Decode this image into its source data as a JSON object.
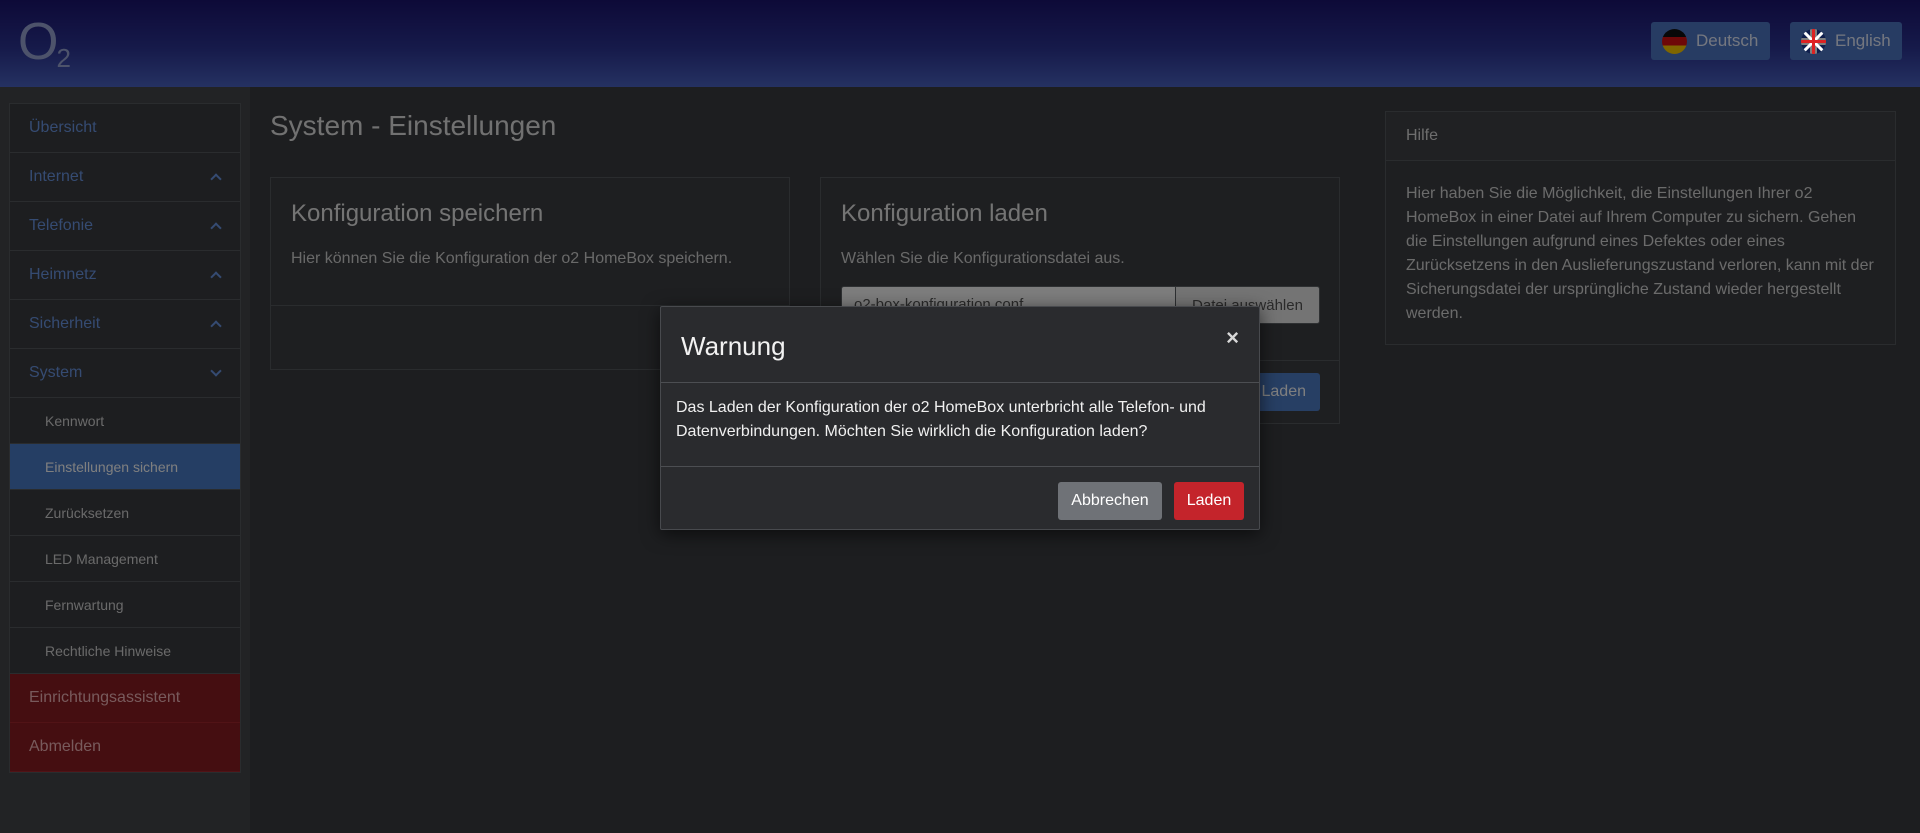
{
  "header": {
    "logo": "O2",
    "languages": [
      {
        "label": "Deutsch",
        "flag": "de-flag-icon"
      },
      {
        "label": "English",
        "flag": "uk-flag-icon"
      }
    ]
  },
  "sidebar": {
    "items": [
      {
        "label": "Übersicht"
      },
      {
        "label": "Internet",
        "icon": "chevron-up-icon"
      },
      {
        "label": "Telefonie",
        "icon": "chevron-up-icon"
      },
      {
        "label": "Heimnetz",
        "icon": "chevron-up-icon"
      },
      {
        "label": "Sicherheit",
        "icon": "chevron-up-icon"
      },
      {
        "label": "System",
        "icon": "chevron-down-icon"
      }
    ],
    "sub_items": [
      {
        "label": "Kennwort"
      },
      {
        "label": "Einstellungen sichern",
        "active": true
      },
      {
        "label": "Zurücksetzen"
      },
      {
        "label": "LED Management"
      },
      {
        "label": "Fernwartung"
      },
      {
        "label": "Rechtliche Hinweise"
      }
    ],
    "bottom_items": [
      {
        "label": "Einrichtungsassistent"
      },
      {
        "label": "Abmelden"
      }
    ]
  },
  "main": {
    "page_title": "System - Einstellungen",
    "save_panel": {
      "title": "Konfiguration speichern",
      "description": "Hier können Sie die Konfiguration der o2 HomeBox speichern."
    },
    "load_panel": {
      "title": "Konfiguration laden",
      "description": "Wählen Sie die Konfigurationsdatei aus.",
      "file_value": "o2-box-konfiguration.conf",
      "file_button": "Datei auswählen",
      "load_button": "Laden"
    },
    "help": {
      "title": "Hilfe",
      "text": "Hier haben Sie die Möglichkeit, die Einstellungen Ihrer o2 HomeBox in einer Datei auf Ihrem Computer zu sichern. Gehen die Einstellungen aufgrund eines Defektes oder eines Zurücksetzens in den Auslieferungszustand verloren, kann mit der Sicherungsdatei der ursprüngliche Zustand wieder hergestellt werden."
    }
  },
  "modal": {
    "title": "Warnung",
    "close": "×",
    "body": "Das Laden der Konfiguration der o2 HomeBox unterbricht alle Telefon- und Datenverbindungen. Möchten Sie wirklich die Konfiguration laden?",
    "cancel_label": "Abbrechen",
    "confirm_label": "Laden"
  },
  "colors": {
    "header_gradient_top": "#1b1470",
    "header_gradient_bottom": "#4a63c4",
    "link_blue": "#6b97e4",
    "active_item": "#4a7cc9",
    "danger_red": "#c4242b",
    "sidebar_red": "#8b1c22"
  }
}
